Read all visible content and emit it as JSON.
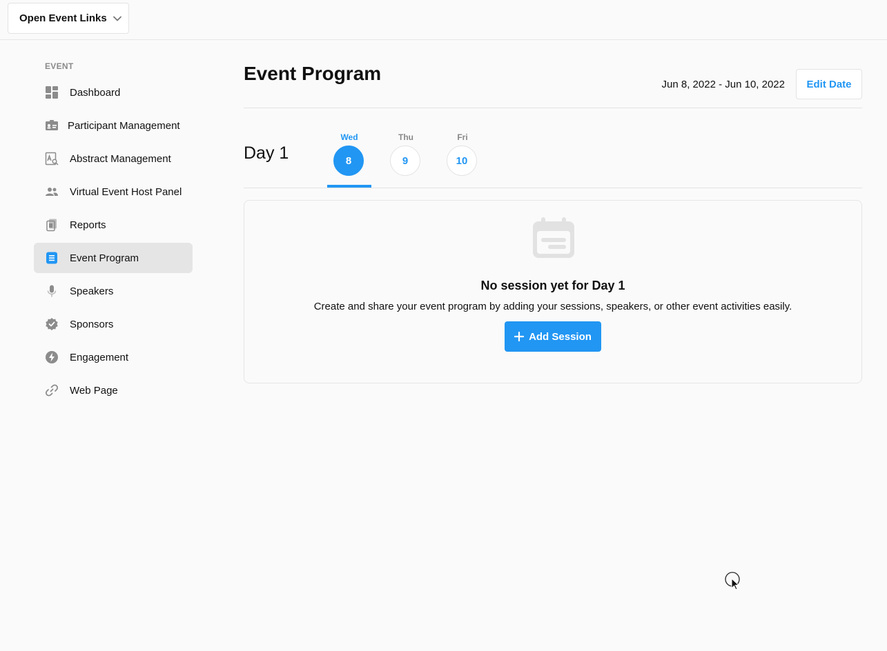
{
  "topbar": {
    "event_links_label": "Open Event Links",
    "event_links_icon": "chevron-down-icon"
  },
  "sidebar": {
    "heading": "EVENT",
    "items": [
      {
        "label": "Dashboard",
        "icon": "dashboard-icon",
        "active": false
      },
      {
        "label": "Participant Management",
        "icon": "id-card-icon",
        "active": false
      },
      {
        "label": "Abstract Management",
        "icon": "document-search-icon",
        "active": false
      },
      {
        "label": "Virtual Event Host Panel",
        "icon": "people-icon",
        "active": false
      },
      {
        "label": "Reports",
        "icon": "reports-icon",
        "active": false
      },
      {
        "label": "Event Program",
        "icon": "list-icon",
        "active": true
      },
      {
        "label": "Speakers",
        "icon": "microphone-icon",
        "active": false
      },
      {
        "label": "Sponsors",
        "icon": "verified-badge-icon",
        "active": false
      },
      {
        "label": "Engagement",
        "icon": "lightning-icon",
        "active": false
      },
      {
        "label": "Web Page",
        "icon": "link-icon",
        "active": false
      }
    ]
  },
  "main": {
    "title": "Event Program",
    "date_range": "Jun 8, 2022 - Jun 10, 2022",
    "edit_date_label": "Edit Date",
    "day_label": "Day 1",
    "days": [
      {
        "weekday": "Wed",
        "day": "8",
        "active": true
      },
      {
        "weekday": "Thu",
        "day": "9",
        "active": false
      },
      {
        "weekday": "Fri",
        "day": "10",
        "active": false
      }
    ],
    "empty_state": {
      "icon": "calendar-icon",
      "title": "No session yet for Day 1",
      "description": "Create and share your event program by adding your sessions, speakers, or other event activities easily.",
      "add_session_label": "Add Session",
      "add_session_icon": "plus-icon"
    }
  },
  "colors": {
    "accent": "#2196f3",
    "active_nav_bg": "#e5e5e5",
    "icon_gray": "#8c8c8c"
  }
}
